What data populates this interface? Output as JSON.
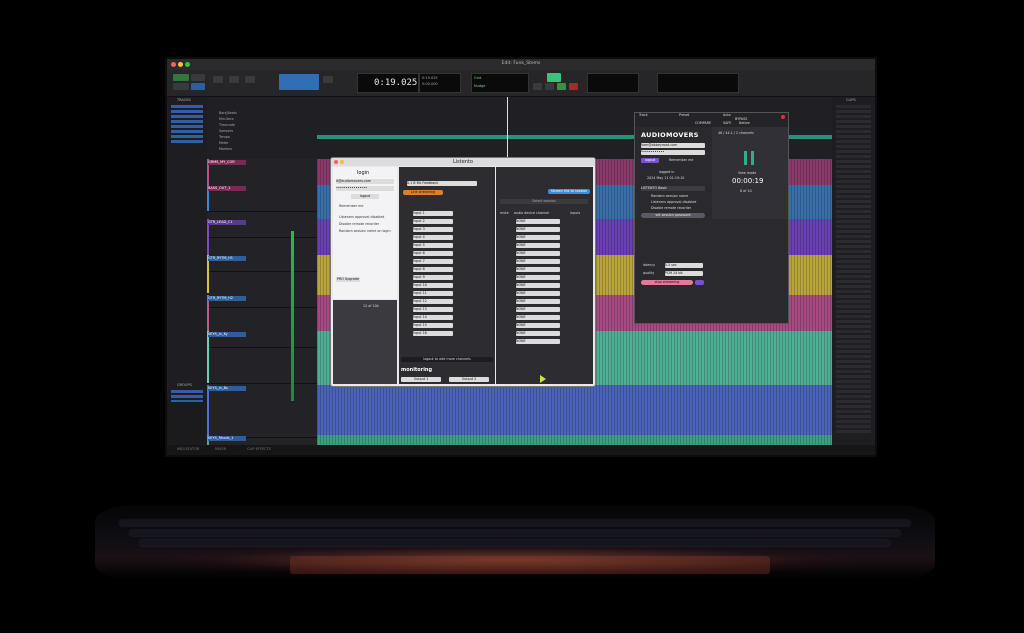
{
  "window": {
    "title": "Edit: Funk_Stems"
  },
  "transport": {
    "counter": "0:19.025",
    "sub_counter_1": "0:19.025",
    "sub_counter_2": "0:00.000",
    "grid": "Grid",
    "nudge": "Nudge"
  },
  "rulers": [
    "Bars|Beats",
    "Min:Secs",
    "Timecode",
    "Samples",
    "Tempo",
    "Meter",
    "Markers"
  ],
  "tracks_panel": {
    "label": "TRACKS",
    "groups_label": "GROUPS"
  },
  "clips_panel": {
    "label": "CLIPS"
  },
  "tracks": [
    {
      "name": "DRMS_MY_COR",
      "color": "#c24b8a"
    },
    {
      "name": "BASS_OUT_1",
      "color": "#3a8ad6"
    },
    {
      "name": "GTR_LEAD_C1",
      "color": "#7a49c9"
    },
    {
      "name": "GTR_RYTM_H1",
      "color": "#d8c43a"
    },
    {
      "name": "GTR_RYTM_H2",
      "color": "#c25a92"
    },
    {
      "name": "KEYS_Jn_Ky",
      "color": "#6ad0b2"
    },
    {
      "name": "KEYS_Jn_Bs",
      "color": "#4f6ed8"
    },
    {
      "name": "KEYS_Rhods_1",
      "color": "#3fb08a"
    }
  ],
  "bottom_tabs": [
    "MIDI EDITOR",
    "MIXER",
    "CLIP EFFECTS"
  ],
  "listento": {
    "title": "Listento",
    "login_heading": "login",
    "email": "lt@audiomovers.com",
    "password_mask": "••••••••••••••••",
    "logout": "logout",
    "remember_me": "Remember me",
    "options": [
      "Listeners approval disabled",
      "Disable remote recorder",
      "Random session name on login"
    ],
    "upgrade_button": "PRO Upgrade",
    "counter": "12 of 104",
    "bitrate": "0.1 B Mk Feedback",
    "link_streaming": "Link streaming",
    "select_session": "Select session",
    "columns": {
      "mute": "mute",
      "audio_device": "audio device channel",
      "inputs": "inputs"
    },
    "inputs": [
      "Input 1",
      "Input 2",
      "Input 3",
      "Input 4",
      "Input 5",
      "Input 6",
      "Input 7",
      "Input 8",
      "Input 9",
      "Input 10",
      "Input 11",
      "Input 12",
      "Input 13",
      "Input 14",
      "Input 15",
      "Input 16"
    ],
    "devices": [
      "NONE",
      "NONE",
      "NONE",
      "NONE",
      "NONE",
      "NONE",
      "NONE",
      "NONE",
      "NONE",
      "NONE",
      "NONE",
      "NONE",
      "NONE",
      "NONE",
      "NONE",
      "NONE"
    ],
    "logout_more": "logout to add more channels",
    "monitoring_heading": "monitoring",
    "output_left": "Output 1",
    "output_right": "Output 2",
    "stream_button": "Stream link to session"
  },
  "audiomovers": {
    "logo": "AUDIOMOVERS",
    "email": "ham@abbeyroad.com",
    "password_mask": "••••••••••••",
    "logout": "logout",
    "remember_me": "Remember me",
    "user": "logged in",
    "date": "2024 May 11 01:19:10",
    "plan": "LISTENTO Basic",
    "options": [
      "Random session name",
      "Listeners approval disabled",
      "Disable remote recorder"
    ],
    "set_password": "set session password",
    "quality_label": "quality",
    "quality_value": "PCM 24 bit",
    "latency_label": "latency",
    "latency_value": "0.5 sec",
    "stop_button": "stop streaming",
    "stats": "48 / 44.1 / 2 channels",
    "elapsed": "00:00:19",
    "listeners_label": "View mode",
    "listeners": "8 of 10",
    "tabs": {
      "track": "Track",
      "preset": "Preset",
      "auto": "Auto"
    },
    "compare": "COMPARE",
    "bypass": "BYPASS",
    "safe": "SAFE",
    "native": "Native"
  }
}
